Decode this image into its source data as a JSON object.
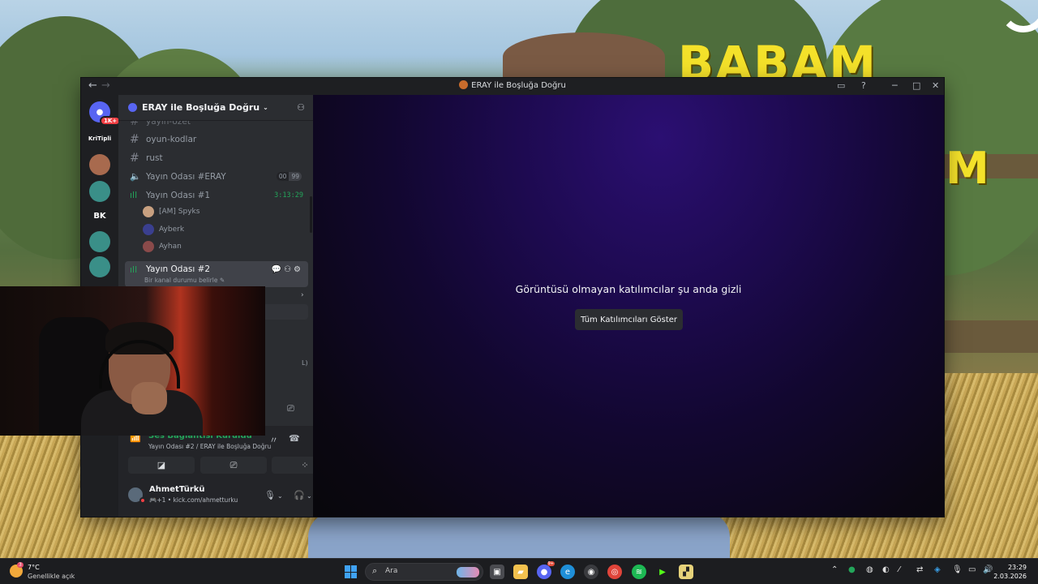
{
  "background": {
    "banner_line1": "BABAM",
    "banner_line2": "M"
  },
  "window": {
    "title": "ERAY ile Boşluğa Doğru",
    "back_icon": "arrow-left-icon",
    "forward_icon": "arrow-right-icon"
  },
  "rail": {
    "discord_badge": "1K+",
    "servers": [
      {
        "label": "KriTipli",
        "color": "#2b2d31"
      },
      {
        "label": "",
        "color": "#a86a4e"
      },
      {
        "label": "",
        "color": "#3a8f88"
      },
      {
        "label": "BK",
        "color": "#1e1f22"
      },
      {
        "label": "",
        "color": "#3a8f88"
      },
      {
        "label": "",
        "color": "#3a8f88"
      }
    ]
  },
  "sidebar": {
    "guild_name": "ERAY ile Boşluğa Doğru",
    "channels": [
      {
        "type": "text",
        "name": "yayın-özet"
      },
      {
        "type": "text",
        "name": "oyun-kodlar"
      },
      {
        "type": "text",
        "name": "rust"
      },
      {
        "type": "voice",
        "name": "Yayın Odası #ERAY",
        "limit_current": "00",
        "limit_max": "99"
      },
      {
        "type": "voice-live",
        "name": "Yayın Odası #1",
        "timer": "3:13:29"
      }
    ],
    "members": [
      {
        "name": "[AM] Spyks",
        "color": "#c8a080"
      },
      {
        "name": "Ayberk",
        "color": "#3a3f8f"
      },
      {
        "name": "Ayhan",
        "color": "#8a4a4a"
      }
    ],
    "active_channel": {
      "name": "Yayın Odası #2",
      "status_placeholder": "Bir kanal durumu belirle"
    },
    "truncated_text": "L)"
  },
  "voice_panel": {
    "status": "Ses Bağlantısı Kuruldu",
    "location": "Yayın Odası #2 / ERAY ile Boşluğa Doğru"
  },
  "user_panel": {
    "username": "AhmetTürkü",
    "subtext": "🎮+1 • kick.com/ahmetturku"
  },
  "stage": {
    "message": "Görüntüsü olmayan katılımcılar şu anda gizli",
    "button_label": "Tüm Katılımcıları Göster"
  },
  "taskbar": {
    "weather_badge": "3",
    "temperature": "7°C",
    "condition": "Genellikle açık",
    "search_placeholder": "Ara",
    "discord_badge": "9+",
    "time": "23:29",
    "date": "2.03.2026"
  }
}
